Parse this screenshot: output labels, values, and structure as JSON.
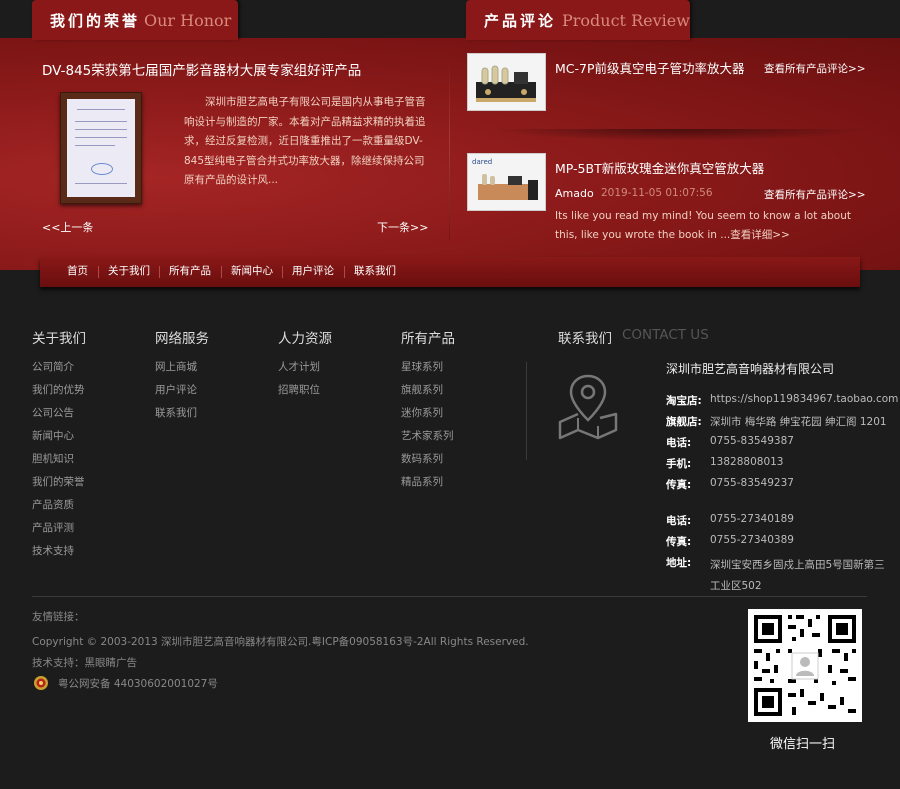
{
  "honor": {
    "tab_cn": "我们的荣誉",
    "tab_en": "Our Honor",
    "title": "DV-845荣获第七届国产影音器材大展专家组好评产品",
    "desc": "深圳市胆艺高电子有限公司是国内从事电子管音响设计与制造的厂家。本着对产品精益求精的执着追求，经过反复检测，近日隆重推出了一款重量级DV-845型纯电子管合并式功率放大器，除继续保持公司原有产品的设计风...",
    "prev": "<<上一条",
    "next": "下一条>>"
  },
  "review": {
    "tab_cn": "产品评论",
    "tab_en": "Product Review",
    "items": [
      {
        "title": "MC-7P前级真空电子管功率放大器",
        "link": "查看所有产品评论>>"
      },
      {
        "title": "MP-5BT新版玫瑰金迷你真空管放大器",
        "link": "查看所有产品评论>>",
        "author": "Amado",
        "date": "2019-11-05 01:07:56",
        "text": "Its like you read my mind! You seem to know a lot about this, like you wrote the book in ...查看详细>>",
        "brand": "dared"
      }
    ]
  },
  "nav": [
    "首页",
    "关于我们",
    "所有产品",
    "新闻中心",
    "用户评论",
    "联系我们"
  ],
  "footer": {
    "columns": [
      {
        "title": "关于我们",
        "links": [
          "公司简介",
          "我们的优势",
          "公司公告",
          "新闻中心",
          "胆机知识",
          "我们的荣誉",
          "产品资质",
          "产品评测",
          "技术支持"
        ]
      },
      {
        "title": "网络服务",
        "links": [
          "网上商城",
          "用户评论",
          "联系我们"
        ]
      },
      {
        "title": "人力资源",
        "links": [
          "人才计划",
          "招聘职位"
        ]
      },
      {
        "title": "所有产品",
        "links": [
          "星球系列",
          "旗舰系列",
          "迷你系列",
          "艺术家系列",
          "数码系列",
          "精品系列"
        ]
      }
    ],
    "contact": {
      "title": "联系我们",
      "title_en": "CONTACT US",
      "company": "深圳市胆艺高音响器材有限公司",
      "rows": [
        {
          "label": "淘宝店:",
          "value": "https://shop119834967.taobao.com"
        },
        {
          "label": "旗舰店:",
          "value": "深圳市 梅华路 绅宝花园 绅汇阁 1201"
        },
        {
          "label": "电话:",
          "value": "0755-83549387"
        },
        {
          "label": "手机:",
          "value": "13828808013"
        },
        {
          "label": "传真:",
          "value": "0755-83549237"
        },
        {
          "label": "电话:",
          "value": "0755-27340189"
        },
        {
          "label": "传真:",
          "value": "0755-27340389"
        },
        {
          "label": "地址:",
          "value": "深圳宝安西乡固戍上高田5号国新第三工业区502"
        }
      ]
    },
    "friend_links": "友情链接：",
    "copyright": "Copyright © 2003-2013 深圳市胆艺高音响器材有限公司.粤ICP备09058163号-2All Rights Reserved.",
    "tech": "技术支持：黑眼睛广告",
    "police": "粤公网安备 44030602001027号",
    "qr_label": "微信扫一扫"
  }
}
